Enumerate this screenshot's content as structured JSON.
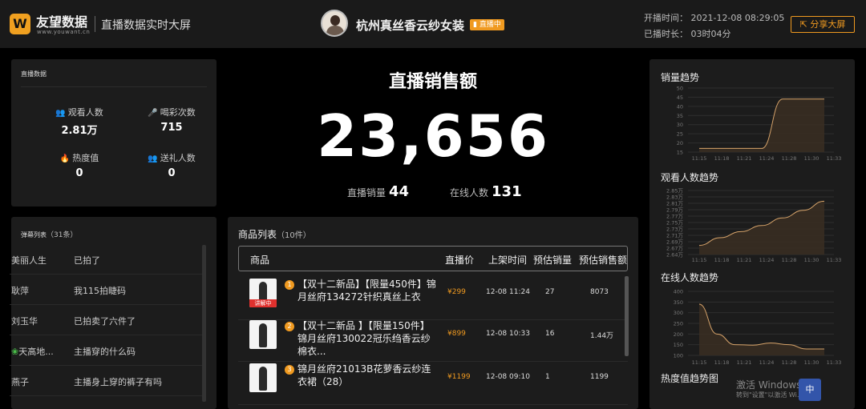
{
  "header": {
    "logo_mark": "W",
    "logo_name": "友望数据",
    "logo_url": "www.youwant.cn",
    "subtitle": "直播数据实时大屏",
    "shop_name": "杭州真丝香云纱女装",
    "live_badge": "直播中",
    "start_time": "开播时间：  2021-12-08 08:29:05",
    "duration": "已播时长：  03时04分",
    "share_button": "分享大屏"
  },
  "live_data": {
    "title": "直播数据",
    "stats": [
      {
        "label": "观看人数",
        "value": "2.81万",
        "icon": "users-icon"
      },
      {
        "label": "喝彩次数",
        "value": "715",
        "icon": "microphone-icon"
      },
      {
        "label": "热度值",
        "value": "0",
        "icon": "fire-icon"
      },
      {
        "label": "送礼人数",
        "value": "0",
        "icon": "users-icon"
      }
    ]
  },
  "danmaku": {
    "title": "弹幕列表",
    "count": "（31条）",
    "rows": [
      {
        "user": "美丽人生",
        "msg": "已拍了"
      },
      {
        "user": "耿萍",
        "msg": "我115拍睫码"
      },
      {
        "user": "刘玉华",
        "msg": "已拍卖了六件了"
      },
      {
        "user": "天高地...",
        "msg": "主播穿的什么码"
      },
      {
        "user": "燕子",
        "msg": "主播身上穿的裤子有吗"
      }
    ]
  },
  "center": {
    "title": "直播销售额",
    "amount": "23,656",
    "sold_label": "直播销量",
    "sold_value": "44",
    "online_label": "在线人数",
    "online_value": "131"
  },
  "products": {
    "title": "商品列表",
    "count": "（10件）",
    "columns": [
      "商品",
      "直播价",
      "上架时间",
      "预估销量",
      "预估销售额"
    ],
    "live_tag": "讲解中",
    "rows": [
      {
        "no": "1",
        "name": "【双十二新品】【限量450件】锦月丝府134272针织真丝上衣",
        "price": "¥299",
        "time": "12-08 11:24",
        "volume": "27",
        "amount": "8073"
      },
      {
        "no": "2",
        "name": "【双十二新品 】【限量150件】锦月丝府130022冠乐绉香云纱棉衣...",
        "price": "¥899",
        "time": "12-08 10:33",
        "volume": "16",
        "amount": "1.44万"
      },
      {
        "no": "3",
        "name": "锦月丝府21013B花萝香云纱连衣裙（28）",
        "price": "¥1199",
        "time": "12-08 09:10",
        "volume": "1",
        "amount": "1199"
      }
    ]
  },
  "charts": {
    "sales_trend_title": "销量趋势",
    "viewers_trend_title": "观看人数趋势",
    "online_trend_title": "在线人数趋势",
    "heat_trend_title": "热度值趋势图"
  },
  "chart_data": [
    {
      "type": "area",
      "title": "销量趋势",
      "x": [
        "11:15",
        "11:18",
        "11:21",
        "11:24",
        "11:28",
        "11:30",
        "11:33"
      ],
      "values": [
        17,
        17,
        17,
        17,
        44,
        44,
        44
      ],
      "yticks": [
        "15",
        "20",
        "25",
        "30",
        "35",
        "40",
        "45",
        "50"
      ],
      "ylim": [
        15,
        50
      ]
    },
    {
      "type": "area",
      "title": "观看人数趋势",
      "x": [
        "11:15",
        "11:18",
        "11:21",
        "11:24",
        "11:28",
        "11:30",
        "11:33"
      ],
      "values": [
        2.67,
        2.695,
        2.715,
        2.735,
        2.76,
        2.785,
        2.815
      ],
      "yticks": [
        "2.64万",
        "2.67万",
        "2.69万",
        "2.71万",
        "2.73万",
        "2.75万",
        "2.77万",
        "2.79万",
        "2.81万",
        "2.83万",
        "2.85万"
      ],
      "ylim": [
        2.64,
        2.85
      ]
    },
    {
      "type": "area",
      "title": "在线人数趋势",
      "x": [
        "11:15",
        "11:18",
        "11:21",
        "11:24",
        "11:28",
        "11:30",
        "11:33"
      ],
      "values": [
        340,
        200,
        150,
        148,
        158,
        150,
        130,
        130
      ],
      "yticks": [
        "100",
        "150",
        "200",
        "250",
        "300",
        "350",
        "400"
      ],
      "ylim": [
        100,
        400
      ]
    }
  ],
  "watermark": {
    "line1": "激活 Windows",
    "line2": "转到\"设置\"以激活 Wi...",
    "ime_label": "中"
  }
}
